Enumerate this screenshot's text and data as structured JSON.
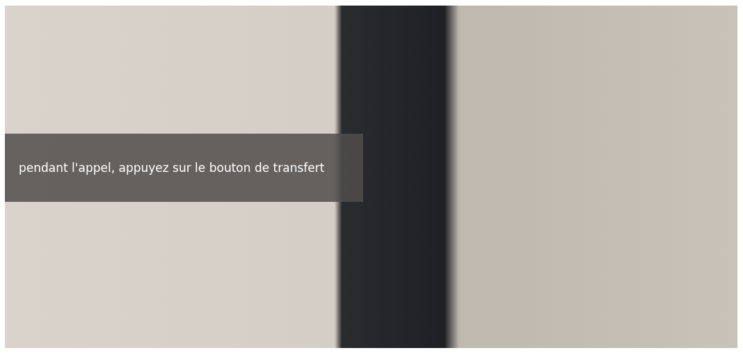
{
  "video": {
    "caption": "pendant l'appel, appuyez sur le bouton de transfert"
  }
}
